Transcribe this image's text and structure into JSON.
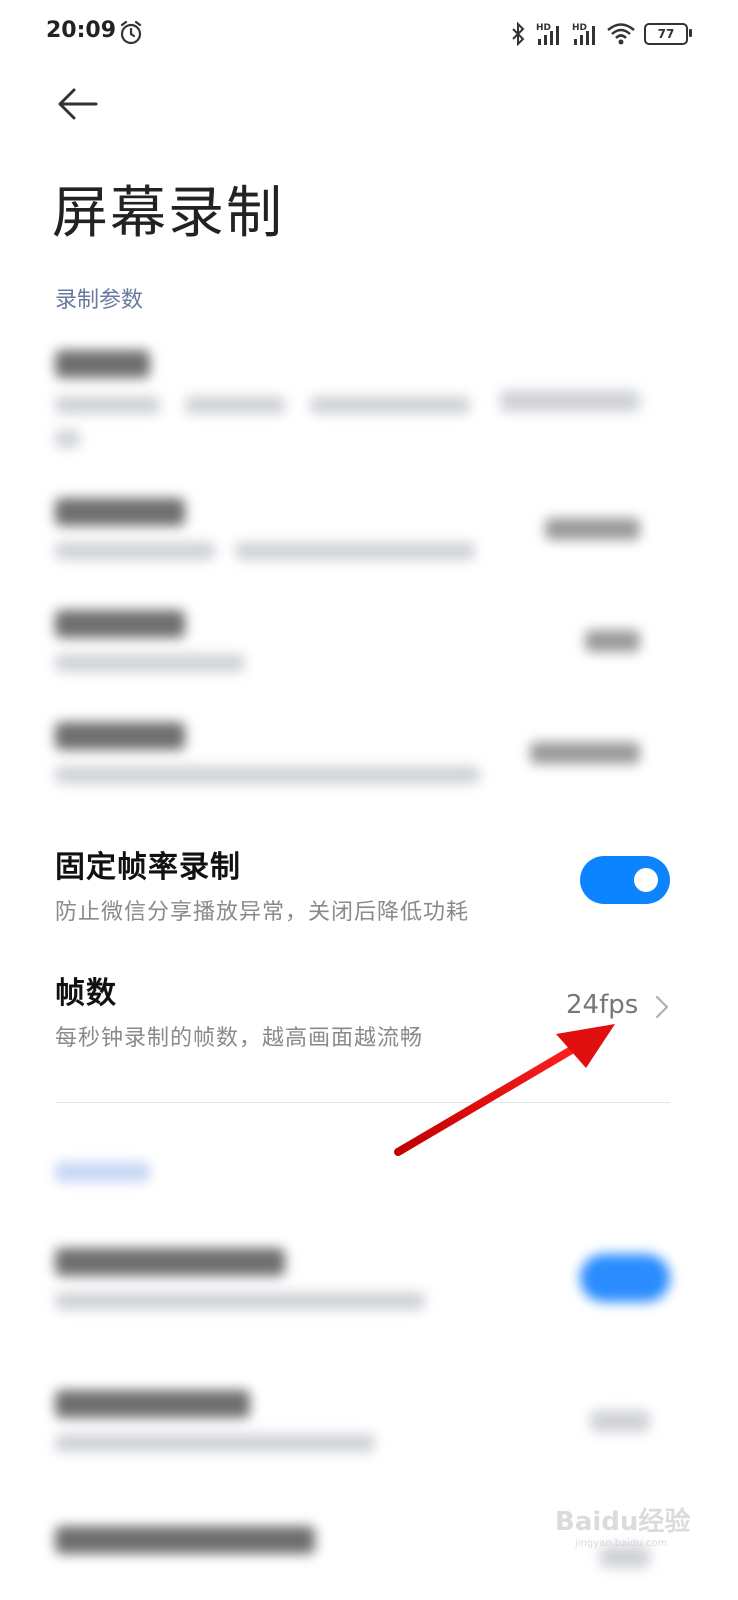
{
  "status_bar": {
    "time": "20:09",
    "battery": "77",
    "network_labels": [
      "HD",
      "HD"
    ]
  },
  "header": {
    "title": "屏幕录制"
  },
  "section": {
    "label": "录制参数"
  },
  "settings": {
    "fixed_frame_rate": {
      "title": "固定帧率录制",
      "subtitle": "防止微信分享播放异常，关闭后降低功耗",
      "enabled": true
    },
    "frame_rate": {
      "title": "帧数",
      "subtitle": "每秒钟录制的帧数，越高画面越流畅",
      "value": "24fps"
    }
  },
  "colors": {
    "accent": "#0d84ff",
    "section_label": "#6a7a9c",
    "annotation_arrow": "#e01010"
  },
  "watermark": {
    "brand": "Baidu经验",
    "site": "jingyan.baidu.com"
  }
}
